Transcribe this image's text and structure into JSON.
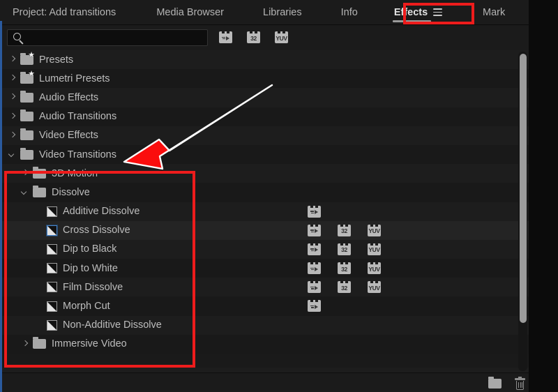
{
  "app": {
    "accent_blue": "#2a5a9e",
    "annotation_red": "#ee1c1c",
    "panel_bg": "#1a1a1a"
  },
  "tabbar": {
    "tabs": [
      {
        "label": "Project: Add transitions",
        "active": false
      },
      {
        "label": "Media Browser",
        "active": false
      },
      {
        "label": "Libraries",
        "active": false
      },
      {
        "label": "Info",
        "active": false
      },
      {
        "label": "Effects",
        "active": true
      },
      {
        "label": "Mark",
        "active": false
      }
    ],
    "overflow_label": "»",
    "menu_icon": "hamburger-menu-icon"
  },
  "search": {
    "placeholder": "",
    "value": "",
    "icon": "search-icon",
    "filters": [
      {
        "name": "accelerated-effects-filter",
        "type": "accel",
        "label": ""
      },
      {
        "name": "32bit-color-filter",
        "type": "text",
        "label": "32"
      },
      {
        "name": "yuv-effects-filter",
        "type": "text",
        "label": "YUV"
      }
    ]
  },
  "tree": {
    "rows": [
      {
        "label": "Presets",
        "indent": 0,
        "icon": "folder-star",
        "twisty": "closed",
        "badges": []
      },
      {
        "label": "Lumetri Presets",
        "indent": 0,
        "icon": "folder-star",
        "twisty": "closed",
        "badges": []
      },
      {
        "label": "Audio Effects",
        "indent": 0,
        "icon": "folder",
        "twisty": "closed",
        "badges": []
      },
      {
        "label": "Audio Transitions",
        "indent": 0,
        "icon": "folder",
        "twisty": "closed",
        "badges": []
      },
      {
        "label": "Video Effects",
        "indent": 0,
        "icon": "folder",
        "twisty": "closed",
        "badges": []
      },
      {
        "label": "Video Transitions",
        "indent": 0,
        "icon": "folder",
        "twisty": "open",
        "badges": []
      },
      {
        "label": "3D Motion",
        "indent": 1,
        "icon": "folder",
        "twisty": "closed",
        "badges": []
      },
      {
        "label": "Dissolve",
        "indent": 1,
        "icon": "folder",
        "twisty": "open",
        "badges": []
      },
      {
        "label": "Additive Dissolve",
        "indent": 2,
        "icon": "transition",
        "twisty": "none",
        "badges": [
          "accel"
        ]
      },
      {
        "label": "Cross Dissolve",
        "indent": 2,
        "icon": "transition-default",
        "twisty": "none",
        "badges": [
          "accel",
          "32",
          "YUV"
        ],
        "selected": true
      },
      {
        "label": "Dip to Black",
        "indent": 2,
        "icon": "transition",
        "twisty": "none",
        "badges": [
          "accel",
          "32",
          "YUV"
        ]
      },
      {
        "label": "Dip to White",
        "indent": 2,
        "icon": "transition",
        "twisty": "none",
        "badges": [
          "accel",
          "32",
          "YUV"
        ]
      },
      {
        "label": "Film Dissolve",
        "indent": 2,
        "icon": "transition",
        "twisty": "none",
        "badges": [
          "accel",
          "32",
          "YUV"
        ]
      },
      {
        "label": "Morph Cut",
        "indent": 2,
        "icon": "transition",
        "twisty": "none",
        "badges": [
          "accel"
        ]
      },
      {
        "label": "Non-Additive Dissolve",
        "indent": 2,
        "icon": "transition",
        "twisty": "none",
        "badges": []
      },
      {
        "label": "Immersive Video",
        "indent": 1,
        "icon": "folder",
        "twisty": "closed",
        "badges": []
      }
    ]
  },
  "bottombar": {
    "new_folder": "new-custom-bin-icon",
    "delete": "delete-icon"
  },
  "annotations": {
    "arrow": "red-arrow-pointing-to-video-transitions",
    "box_tab": "red-box-around-effects-tab",
    "box_tree": "red-box-around-dissolve-transitions"
  },
  "scrollbar": {
    "orientation": "vertical"
  }
}
